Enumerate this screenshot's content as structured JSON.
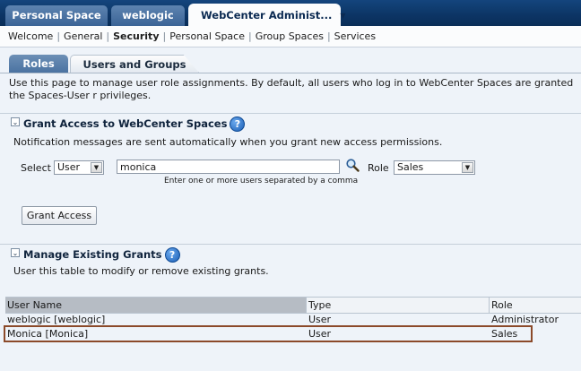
{
  "top_tabs": [
    {
      "label": "Personal Space"
    },
    {
      "label": "weblogic"
    },
    {
      "label": "WebCenter Administ..."
    }
  ],
  "sub_nav": {
    "items": [
      "Welcome",
      "General",
      "Security",
      "Personal Space",
      "Group Spaces",
      "Services"
    ],
    "selected": "Security"
  },
  "inner_tabs": [
    "Roles",
    "Users and Groups"
  ],
  "intro_text": "Use this page to manage user role assignments. By default, all users who log in to WebCenter Spaces are granted the Spaces-User r privileges.",
  "grant_section": {
    "title": "Grant Access to WebCenter Spaces",
    "note": "Notification messages are sent automatically when you grant new access permissions.",
    "select_label": "Select",
    "select_value": "User",
    "user_input_value": "monica",
    "role_label": "Role",
    "role_value": "Sales",
    "hint": "Enter one or more users separated by a comma",
    "grant_button": "Grant Access"
  },
  "manage_section": {
    "title": "Manage Existing Grants",
    "note": "User this table to modify or remove existing grants.",
    "columns": [
      "User Name",
      "Type",
      "Role"
    ],
    "rows": [
      {
        "user": "weblogic [weblogic]",
        "type": "User",
        "role": "Administrator"
      },
      {
        "user": "Monica [Monica]",
        "type": "User",
        "role": "Sales"
      }
    ]
  },
  "help_glyph": "?",
  "colors": {
    "top_bar": "#0c3464",
    "highlight_box": "#8b4a2a",
    "selected_header_cell": "#b6bcc4"
  }
}
